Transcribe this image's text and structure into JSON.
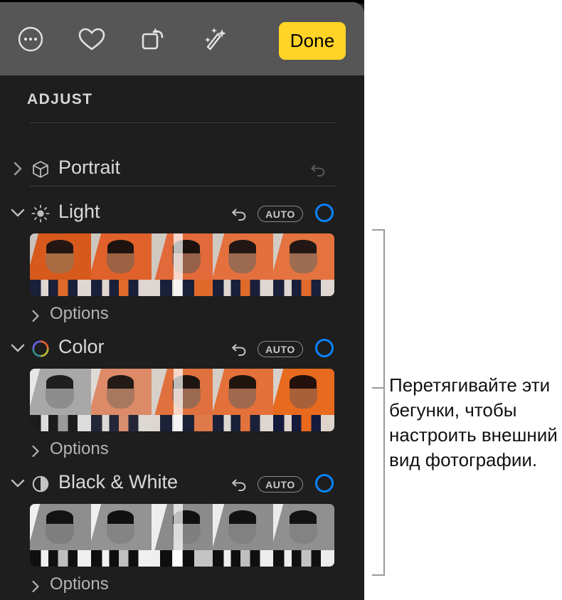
{
  "toolbar": {
    "buttons": [
      {
        "name": "more-options-icon",
        "label": "More"
      },
      {
        "name": "favorite-heart-icon",
        "label": "Favorite"
      },
      {
        "name": "rotate-icon",
        "label": "Rotate"
      },
      {
        "name": "magic-wand-enhance-icon",
        "label": "Enhance"
      }
    ],
    "done_label": "Done",
    "done_color": "#FFD426",
    "background": "#565656"
  },
  "panel": {
    "title": "ADJUST",
    "background": "#1e1e1e",
    "accent_blue": "#0a84ff"
  },
  "sections": [
    {
      "id": "portrait",
      "label": "Portrait",
      "icon": "cube-icon",
      "expanded": false,
      "chevron": "chevron-right-icon",
      "reset_label": "reset-arrow-icon",
      "reset_enabled": false,
      "has_auto": false,
      "has_knob": false,
      "has_strip": false,
      "options_label": "Options"
    },
    {
      "id": "light",
      "label": "Light",
      "icon": "sun-icon",
      "expanded": true,
      "chevron": "chevron-down-icon",
      "reset_label": "reset-arrow-icon",
      "reset_enabled": true,
      "has_auto": true,
      "auto_label": "AUTO",
      "has_knob": true,
      "has_strip": true,
      "options_label": "Options",
      "strip_kind": "light"
    },
    {
      "id": "color",
      "label": "Color",
      "icon": "color-wheel-icon",
      "expanded": true,
      "chevron": "chevron-down-icon",
      "reset_label": "reset-arrow-icon",
      "reset_enabled": true,
      "has_auto": true,
      "auto_label": "AUTO",
      "has_knob": true,
      "has_strip": true,
      "options_label": "Options",
      "strip_kind": "color"
    },
    {
      "id": "bw",
      "label": "Black & White",
      "icon": "half-circle-contrast-icon",
      "expanded": true,
      "chevron": "chevron-down-icon",
      "reset_label": "reset-arrow-icon",
      "reset_enabled": true,
      "has_auto": true,
      "auto_label": "AUTO",
      "has_knob": true,
      "has_strip": true,
      "options_label": "Options",
      "strip_kind": "bw"
    }
  ],
  "callout": {
    "text": "Перетягивайте эти бегунки, чтобы настроить внешний вид фотографии.",
    "line_color": "#9a9a9a"
  }
}
